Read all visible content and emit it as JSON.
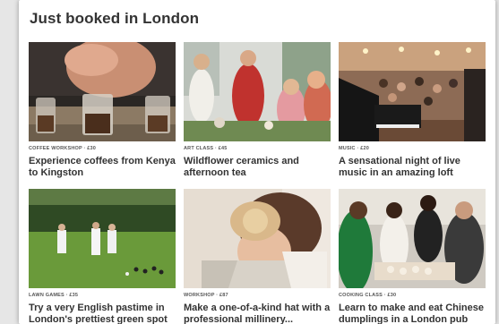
{
  "heading": "Just booked in London",
  "experiences": [
    {
      "category": "COFFEE WORKSHOP · £30",
      "title": "Experience coffees from Kenya to Kingston",
      "image": "coffee-tasting-photo"
    },
    {
      "category": "ART CLASS · £45",
      "title": "Wildflower ceramics and afternoon tea",
      "image": "ceramics-class-photo"
    },
    {
      "category": "MUSIC · £20",
      "title": "A sensational night of live music in an amazing loft",
      "image": "live-music-photo"
    },
    {
      "category": "LAWN GAMES · £35",
      "title": "Try a very English pastime in London's prettiest green spot",
      "image": "lawn-bowls-photo"
    },
    {
      "category": "WORKSHOP · £87",
      "title": "Make a one-of-a-kind hat with a professional millinery...",
      "image": "hat-making-photo"
    },
    {
      "category": "COOKING CLASS · £30",
      "title": "Learn to make and eat Chinese dumplings in a London pub",
      "image": "dumpling-class-photo"
    }
  ]
}
